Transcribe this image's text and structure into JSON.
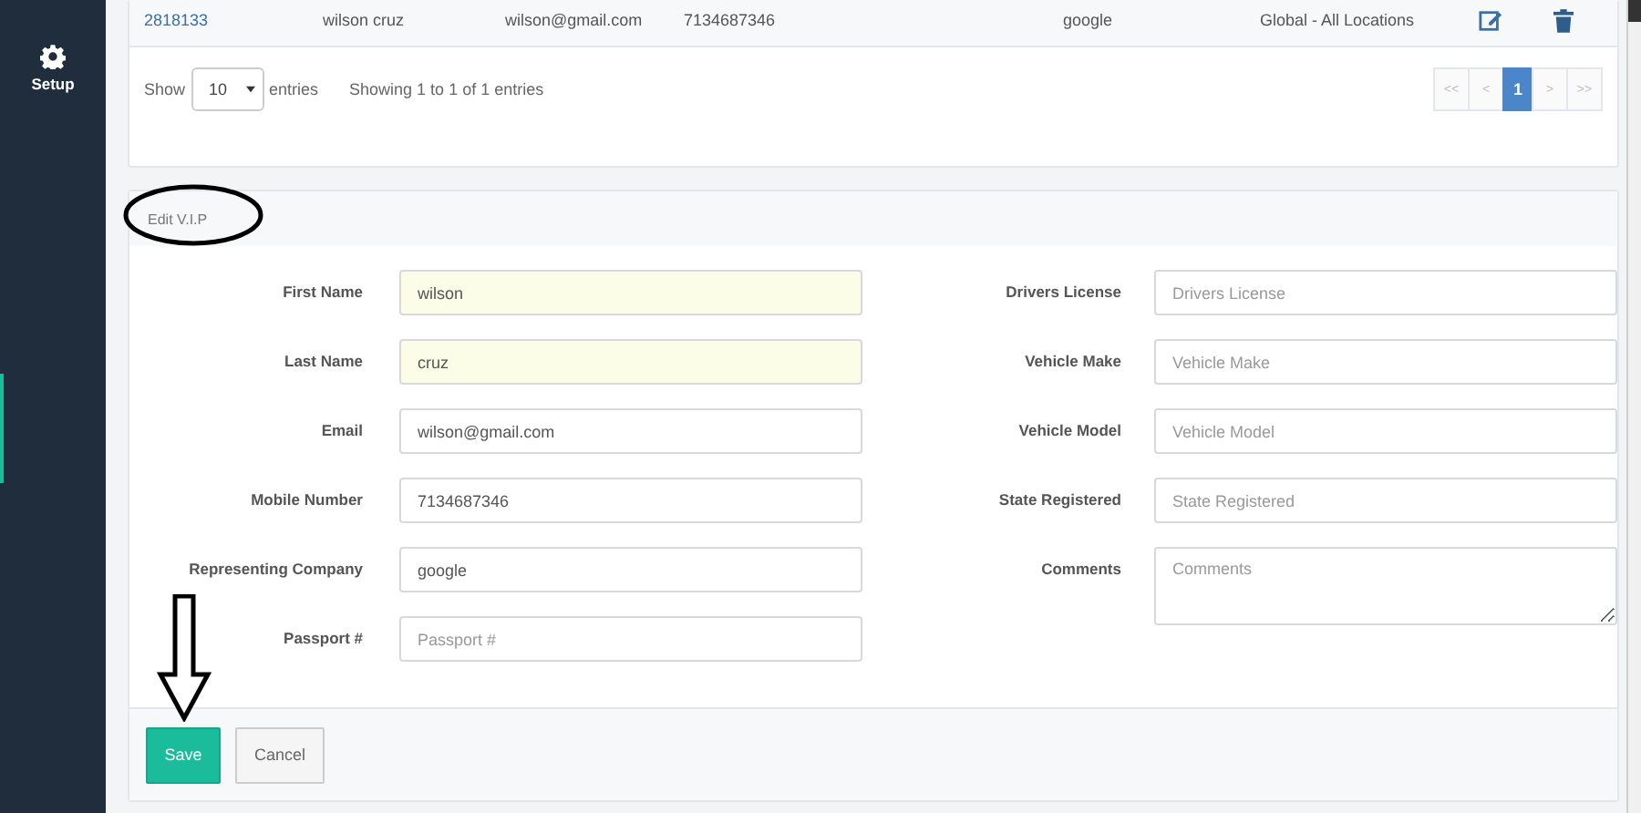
{
  "sidebar": {
    "items": [
      {
        "label": "Setup"
      }
    ]
  },
  "table": {
    "row": {
      "cells": [
        {
          "kind": "link",
          "text": "2818133"
        },
        {
          "kind": "text",
          "text": "wilson cruz"
        },
        {
          "kind": "text",
          "text": "wilson@gmail.com"
        },
        {
          "kind": "text",
          "text": "7134687346"
        },
        {
          "kind": "text",
          "text": "google"
        },
        {
          "kind": "text",
          "text": "Global - All Locations"
        },
        {
          "kind": "edit"
        },
        {
          "kind": "delete"
        }
      ]
    },
    "length": {
      "before": "Show",
      "value": "10",
      "after": "entries"
    },
    "info": "Showing 1 to 1 of 1 entries",
    "pagination": [
      {
        "label": "<<",
        "selected": false
      },
      {
        "label": "<",
        "selected": false
      },
      {
        "label": "1",
        "selected": true
      },
      {
        "label": ">",
        "selected": false
      },
      {
        "label": ">>",
        "selected": false
      }
    ]
  },
  "form": {
    "title": "Edit V.I.P",
    "left": [
      {
        "label": "First Name",
        "value": "wilson",
        "autofilled": true
      },
      {
        "label": "Last Name",
        "value": "cruz",
        "autofilled": true
      },
      {
        "label": "Email",
        "value": "wilson@gmail.com",
        "autofilled": false
      },
      {
        "label": "Mobile Number",
        "value": "7134687346",
        "autofilled": false
      },
      {
        "label": "Representing Company",
        "value": "google",
        "autofilled": false
      },
      {
        "label": "Passport #",
        "placeholder": "Passport #",
        "autofilled": false
      }
    ],
    "right": [
      {
        "label": "Drivers License",
        "placeholder": "Drivers License",
        "kind": "input"
      },
      {
        "label": "Vehicle Make",
        "placeholder": "Vehicle Make",
        "kind": "input"
      },
      {
        "label": "Vehicle Model",
        "placeholder": "Vehicle Model",
        "kind": "input"
      },
      {
        "label": "State Registered",
        "placeholder": "State Registered",
        "kind": "input"
      },
      {
        "label": "Comments",
        "placeholder": "Comments",
        "kind": "textarea"
      }
    ],
    "buttons": [
      {
        "label": "Save",
        "kind": "primary"
      },
      {
        "label": "Cancel",
        "kind": "default"
      }
    ]
  }
}
